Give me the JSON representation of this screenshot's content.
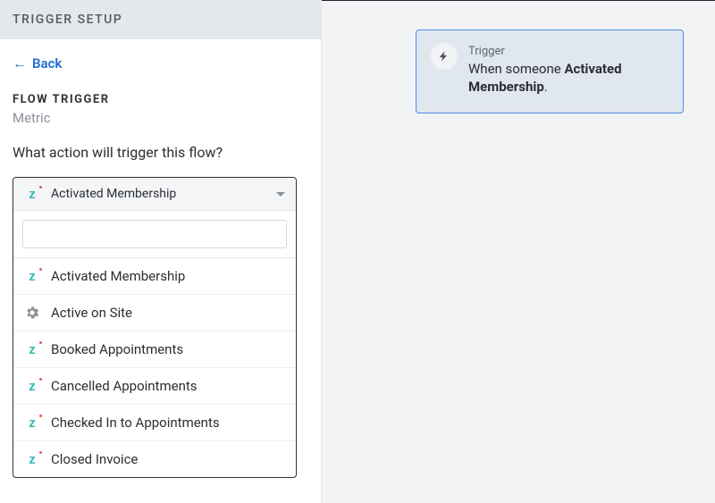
{
  "header": {
    "title": "TRIGGER SETUP"
  },
  "back": {
    "label": "Back"
  },
  "section": {
    "label": "FLOW TRIGGER",
    "sub": "Metric",
    "question": "What action will trigger this flow?"
  },
  "dropdown": {
    "selected": "Activated Membership",
    "search_placeholder": "",
    "options": [
      {
        "label": "Activated Membership",
        "icon": "z"
      },
      {
        "label": "Active on Site",
        "icon": "gear"
      },
      {
        "label": "Booked Appointments",
        "icon": "z"
      },
      {
        "label": "Cancelled Appointments",
        "icon": "z"
      },
      {
        "label": "Checked In to Appointments",
        "icon": "z"
      },
      {
        "label": "Closed Invoice",
        "icon": "z"
      }
    ]
  },
  "canvas": {
    "trigger_card": {
      "label": "Trigger",
      "prefix": "When someone ",
      "bold": "Activated Membership",
      "suffix": "."
    }
  }
}
